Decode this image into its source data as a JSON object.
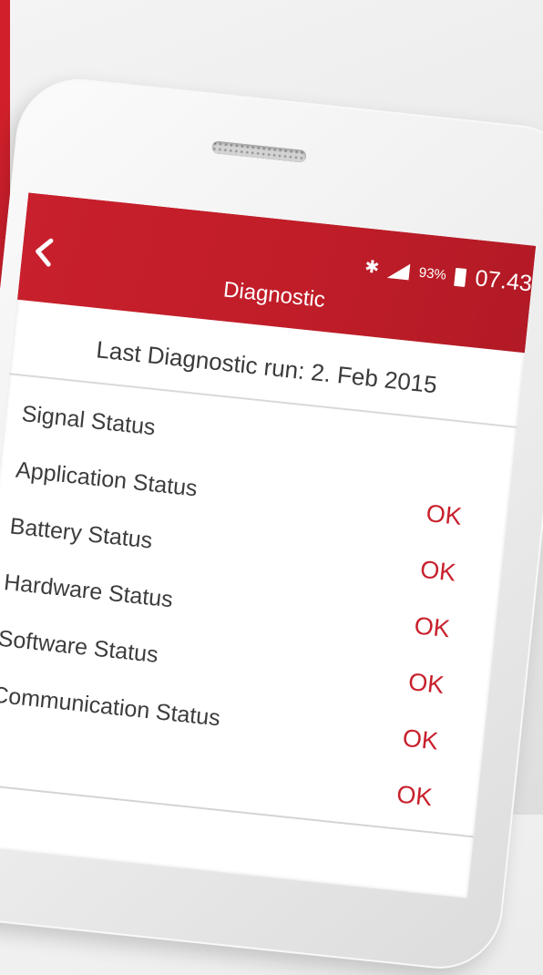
{
  "status_bar": {
    "battery": "93%",
    "time": "07.43"
  },
  "header": {
    "title": "Diagnostic"
  },
  "last_run": "Last Diagnostic run: 2. Feb 2015",
  "statuses": [
    {
      "label": "Signal Status",
      "value": ""
    },
    {
      "label": "Application Status",
      "value": "OK"
    },
    {
      "label": "Battery Status",
      "value": "OK"
    },
    {
      "label": "Hardware Status",
      "value": "OK"
    },
    {
      "label": "Software Status",
      "value": "OK"
    },
    {
      "label": "Communication Status",
      "value": "OK"
    },
    {
      "label": "",
      "value": "OK"
    }
  ],
  "icons": {
    "back": "chevron-left-icon",
    "bluetooth": "bluetooth-icon",
    "signal": "signal-icon",
    "battery": "battery-icon"
  },
  "colors": {
    "accent": "#c8202c",
    "background": "#ececec"
  }
}
